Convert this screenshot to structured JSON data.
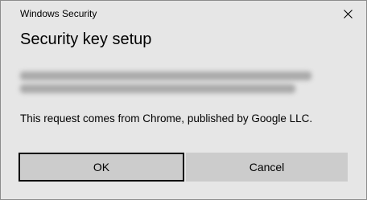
{
  "window": {
    "title": "Windows Security",
    "close_icon": "close-icon"
  },
  "dialog": {
    "heading": "Security key setup",
    "request_text": "This request comes from Chrome, published by Google LLC."
  },
  "buttons": {
    "ok_label": "OK",
    "cancel_label": "Cancel"
  },
  "colors": {
    "dialog_background": "#e6e6e6",
    "button_background": "#cccccc",
    "focus_border": "#000000",
    "window_border": "#8c8c8c"
  }
}
